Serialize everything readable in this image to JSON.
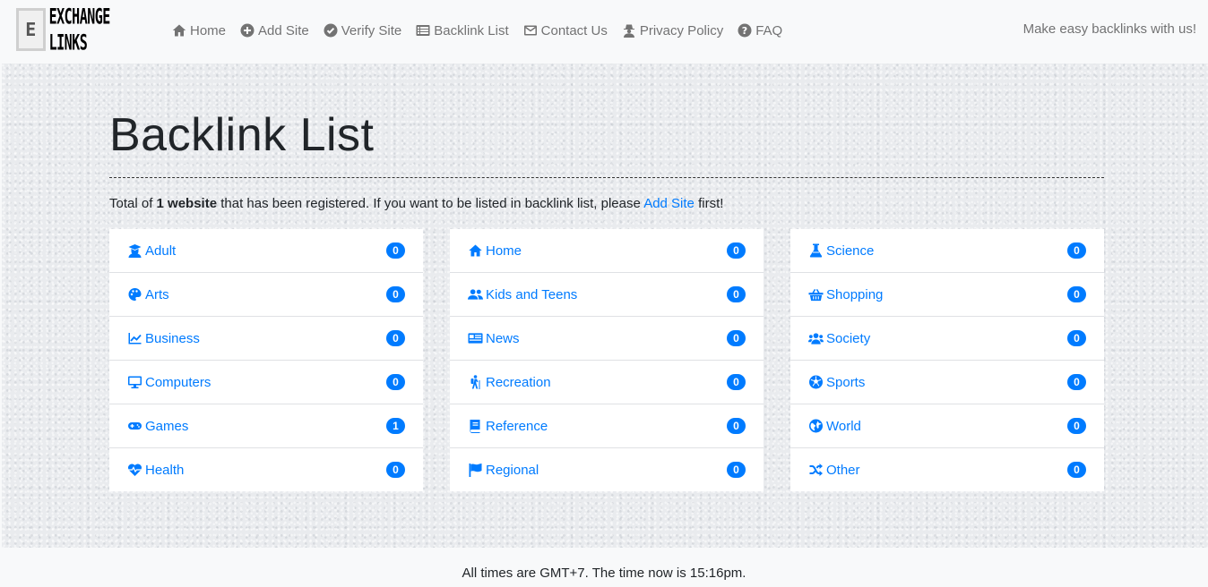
{
  "brand": {
    "mark": "E",
    "name": "EXCHANGE LINKS"
  },
  "nav": [
    {
      "label": "Home",
      "icon": "home-icon"
    },
    {
      "label": "Add Site",
      "icon": "plus-circle-icon"
    },
    {
      "label": "Verify Site",
      "icon": "check-circle-icon"
    },
    {
      "label": "Backlink List",
      "icon": "list-icon"
    },
    {
      "label": "Contact Us",
      "icon": "envelope-icon"
    },
    {
      "label": "Privacy Policy",
      "icon": "user-secret-icon"
    },
    {
      "label": "FAQ",
      "icon": "question-circle-icon"
    }
  ],
  "tagline": "Make easy backlinks with us!",
  "page": {
    "title": "Backlink List",
    "intro_prefix": "Total of ",
    "intro_bold": "1 website",
    "intro_middle": " that has been registered. If you want to be listed in backlink list, please ",
    "intro_link": "Add Site",
    "intro_suffix": " first!"
  },
  "categories": [
    [
      {
        "label": "Adult",
        "count": "0",
        "icon": "user-graduate-icon"
      },
      {
        "label": "Arts",
        "count": "0",
        "icon": "palette-icon"
      },
      {
        "label": "Business",
        "count": "0",
        "icon": "chart-line-icon"
      },
      {
        "label": "Computers",
        "count": "0",
        "icon": "desktop-icon"
      },
      {
        "label": "Games",
        "count": "1",
        "icon": "gamepad-icon"
      },
      {
        "label": "Health",
        "count": "0",
        "icon": "heartbeat-icon"
      }
    ],
    [
      {
        "label": "Home",
        "count": "0",
        "icon": "home-icon"
      },
      {
        "label": "Kids and Teens",
        "count": "0",
        "icon": "user-friends-icon"
      },
      {
        "label": "News",
        "count": "0",
        "icon": "newspaper-icon"
      },
      {
        "label": "Recreation",
        "count": "0",
        "icon": "hiking-icon"
      },
      {
        "label": "Reference",
        "count": "0",
        "icon": "book-icon"
      },
      {
        "label": "Regional",
        "count": "0",
        "icon": "flag-icon"
      }
    ],
    [
      {
        "label": "Science",
        "count": "0",
        "icon": "flask-icon"
      },
      {
        "label": "Shopping",
        "count": "0",
        "icon": "shopping-basket-icon"
      },
      {
        "label": "Society",
        "count": "0",
        "icon": "users-icon"
      },
      {
        "label": "Sports",
        "count": "0",
        "icon": "futbol-icon"
      },
      {
        "label": "World",
        "count": "0",
        "icon": "globe-icon"
      },
      {
        "label": "Other",
        "count": "0",
        "icon": "random-icon"
      }
    ]
  ],
  "footer": "All times are GMT+7. The time now is 15:16pm.",
  "colors": {
    "link": "#007bff",
    "badge": "#007bff",
    "nav_text": "#737373"
  }
}
